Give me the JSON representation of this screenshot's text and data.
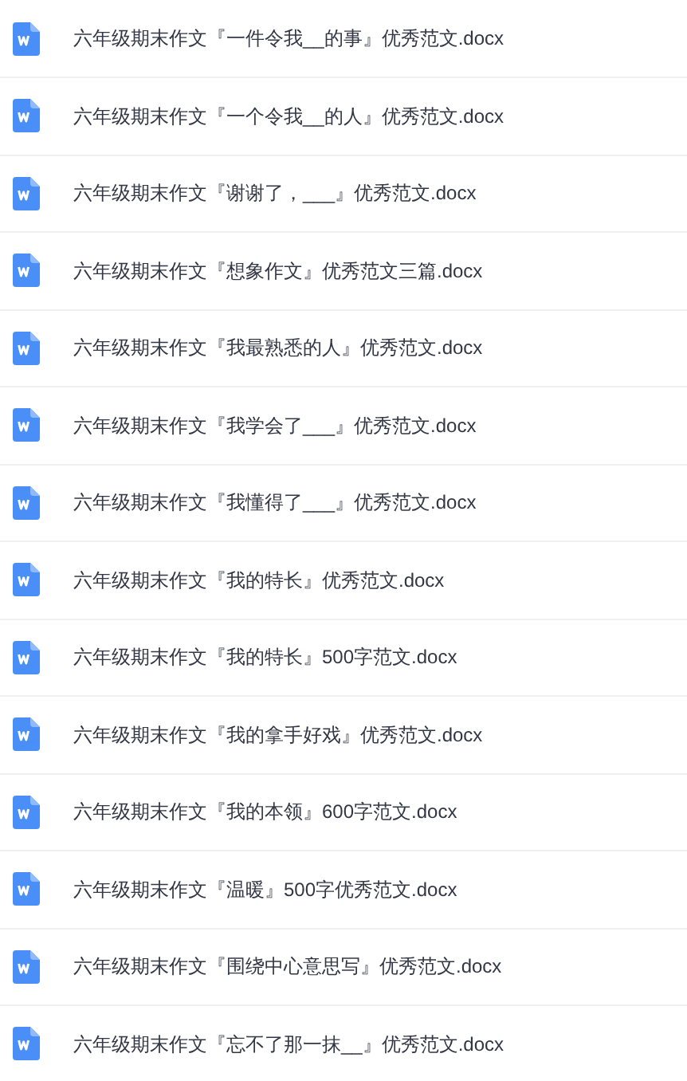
{
  "files": [
    {
      "name": "六年级期末作文『一件令我__的事』优秀范文.docx"
    },
    {
      "name": "六年级期末作文『一个令我__的人』优秀范文.docx"
    },
    {
      "name": "六年级期末作文『谢谢了，___』优秀范文.docx"
    },
    {
      "name": "六年级期末作文『想象作文』优秀范文三篇.docx"
    },
    {
      "name": "六年级期末作文『我最熟悉的人』优秀范文.docx"
    },
    {
      "name": "六年级期末作文『我学会了___』优秀范文.docx"
    },
    {
      "name": "六年级期末作文『我懂得了___』优秀范文.docx"
    },
    {
      "name": "六年级期末作文『我的特长』优秀范文.docx"
    },
    {
      "name": "六年级期末作文『我的特长』500字范文.docx"
    },
    {
      "name": "六年级期末作文『我的拿手好戏』优秀范文.docx"
    },
    {
      "name": "六年级期末作文『我的本领』600字范文.docx"
    },
    {
      "name": "六年级期末作文『温暖』500字优秀范文.docx"
    },
    {
      "name": "六年级期末作文『围绕中心意思写』优秀范文.docx"
    },
    {
      "name": "六年级期末作文『忘不了那一抹__』优秀范文.docx"
    }
  ]
}
